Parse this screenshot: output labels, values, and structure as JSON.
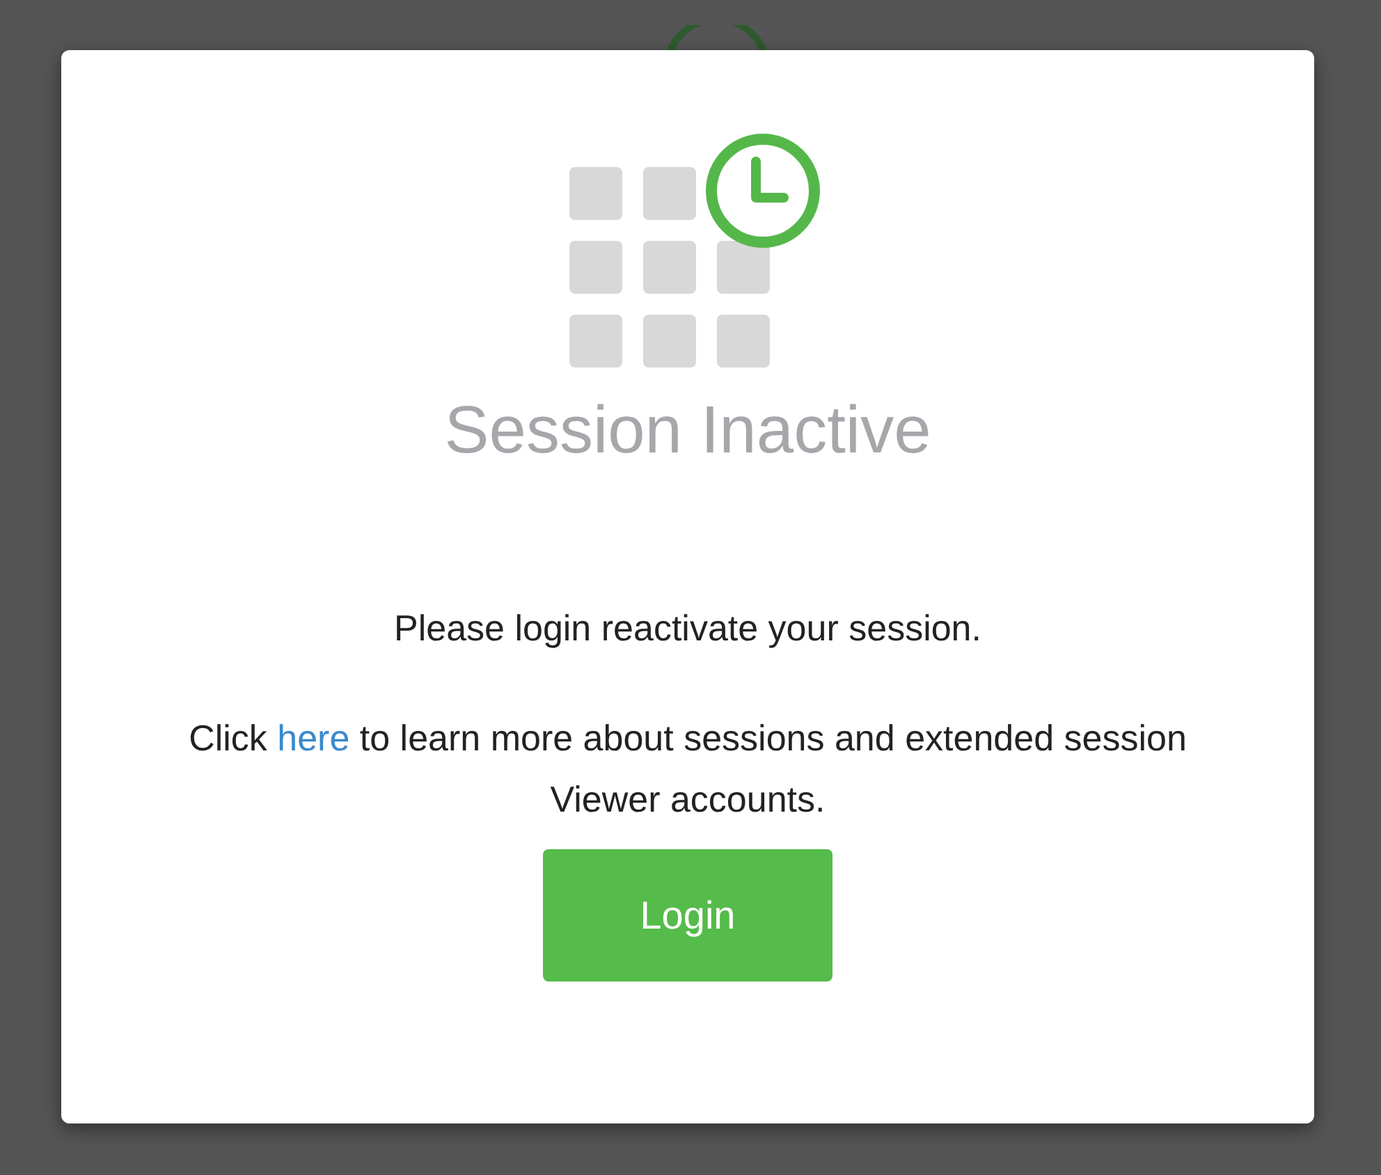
{
  "dialog": {
    "title": "Session Inactive",
    "message": "Please login reactivate your session.",
    "info": {
      "before": "Click ",
      "link": "here",
      "after": " to learn more about sessions and extended session Viewer accounts."
    },
    "button": "Login"
  }
}
